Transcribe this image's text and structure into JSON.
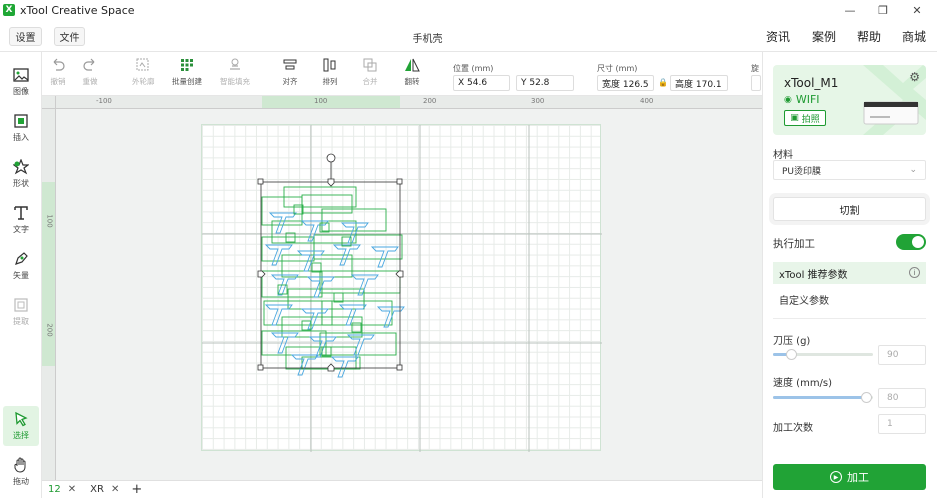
{
  "window": {
    "title": "xTool Creative Space",
    "logo": "X"
  },
  "menu": {
    "settings": "设置",
    "file": "文件",
    "doc_title": "手机壳",
    "links": [
      "资讯",
      "案例",
      "帮助",
      "商城"
    ]
  },
  "left_tools": [
    {
      "label": "图像",
      "icon": "image-icon"
    },
    {
      "label": "插入",
      "icon": "insert-icon"
    },
    {
      "label": "形状",
      "icon": "shape-icon"
    },
    {
      "label": "文字",
      "icon": "text-icon"
    },
    {
      "label": "矢量",
      "icon": "pen-icon"
    },
    {
      "label": "提取",
      "icon": "extract-icon"
    },
    {
      "label": "选择",
      "icon": "cursor-icon"
    },
    {
      "label": "拖动",
      "icon": "hand-icon"
    }
  ],
  "toolbar": {
    "undo": "撤销",
    "redo": "重做",
    "outline": "外轮廓",
    "batch": "批量创建",
    "smart_fill": "智能填充",
    "align": "对齐",
    "arrange": "排列",
    "combine": "合并",
    "flip": "翻转",
    "position_label": "位置 (mm)",
    "x": "X 54.6",
    "y": "Y 52.8",
    "size_label": "尺寸 (mm)",
    "width": "宽度 126.5",
    "height": "高度 170.1",
    "rotate_label": "旋"
  },
  "ruler": {
    "top": [
      "-100",
      "100",
      "200",
      "300",
      "400"
    ],
    "left": [
      "100",
      "200"
    ]
  },
  "tabs": [
    {
      "label": "12",
      "active": true
    },
    {
      "label": "XR",
      "active": false
    },
    {
      "label": "+"
    }
  ],
  "panel": {
    "device_name": "xTool_M1",
    "wifi": "WIFI",
    "photo": "拍照",
    "material_label": "材料",
    "material": "PU烫印膜",
    "cut": "切割",
    "execute": "执行加工",
    "recommended": "xTool 推荐参数",
    "custom": "自定义参数",
    "pressure_label": "刀压 (g)",
    "pressure": "90",
    "speed_label": "速度 (mm/s)",
    "speed": "80",
    "passes_label": "加工次数",
    "passes": "1",
    "run": "加工"
  },
  "colors": {
    "accent": "#21a336",
    "shape": "#2bb04a",
    "pattern": "#4aa7e0"
  }
}
